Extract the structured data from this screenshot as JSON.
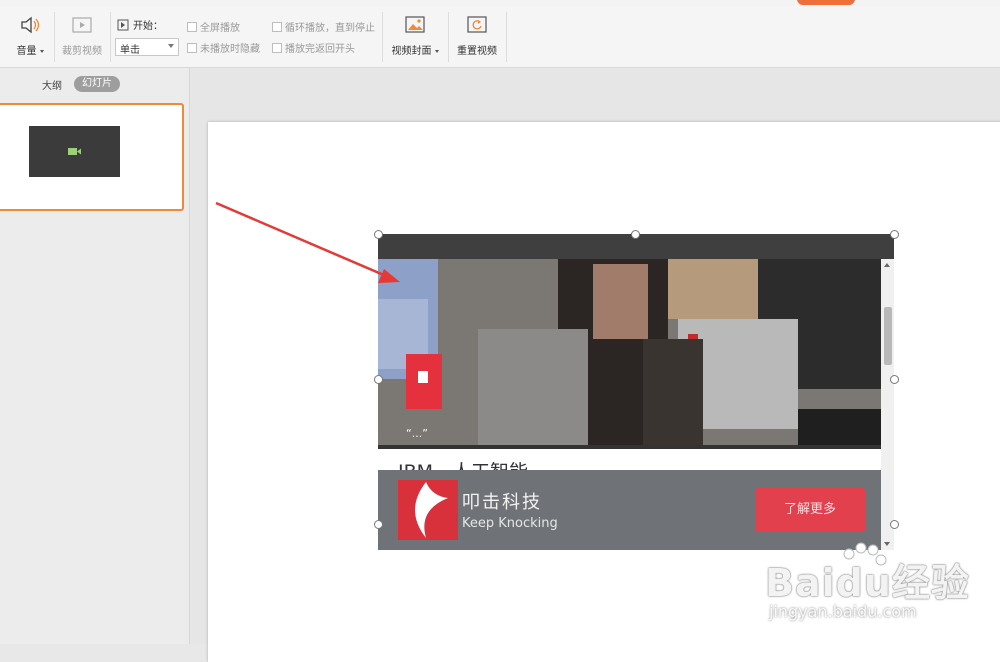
{
  "ribbon": {
    "volume_label": "音量",
    "trim_label": "裁剪视频",
    "start_label": "开始：",
    "start_value": "单击",
    "fullscreen_label": "全屏播放",
    "hide_label": "未播放时隐藏",
    "loop_label": "循环播放，直到停止",
    "rewind_label": "播放完返回开头",
    "cover_label": "视频封面",
    "reset_label": "重置视频"
  },
  "left_panel": {
    "outline_tab": "大纲",
    "slides_tab": "幻灯片"
  },
  "video": {
    "headline": "IBM…人工智能",
    "ad_title": "叩击科技",
    "ad_subtitle": "Keep Knocking",
    "ad_button": "了解更多"
  },
  "watermark": {
    "brand": "Baidu经验",
    "url": "jingyan.baidu.com"
  },
  "colors": {
    "accent_orange": "#ef8a3c",
    "menu_highlight": "#ef6f3b",
    "annotation_arrow": "#e53935",
    "ad_red": "#e2404d",
    "video_dark": "#3f3f3f"
  }
}
